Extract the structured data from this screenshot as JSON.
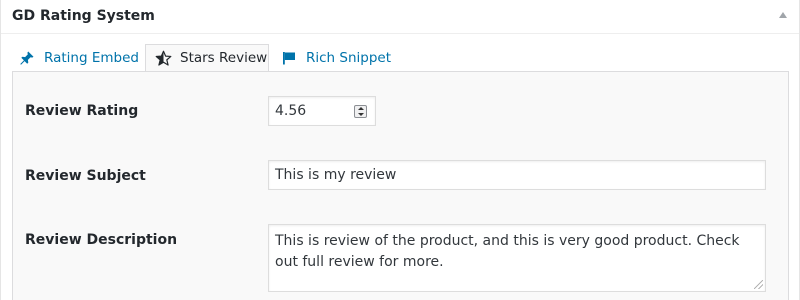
{
  "metabox": {
    "title": "GD Rating System",
    "toggle_icon": "caret-up-icon"
  },
  "tabs": [
    {
      "label": "Rating Embed",
      "icon": "pin-icon",
      "active": false
    },
    {
      "label": "Stars Review",
      "icon": "star-half-icon",
      "active": true
    },
    {
      "label": "Rich Snippet",
      "icon": "flag-icon",
      "active": false
    }
  ],
  "form": {
    "rating": {
      "label": "Review Rating",
      "value": "4.56"
    },
    "subject": {
      "label": "Review Subject",
      "value": "This is my review"
    },
    "description": {
      "label": "Review Description",
      "value": "This is review of the product, and this is very good product. Check out full review for more."
    }
  },
  "colors": {
    "link": "#0073aa",
    "panel_bg": "#f9f9f9",
    "border": "#dcdcde"
  }
}
